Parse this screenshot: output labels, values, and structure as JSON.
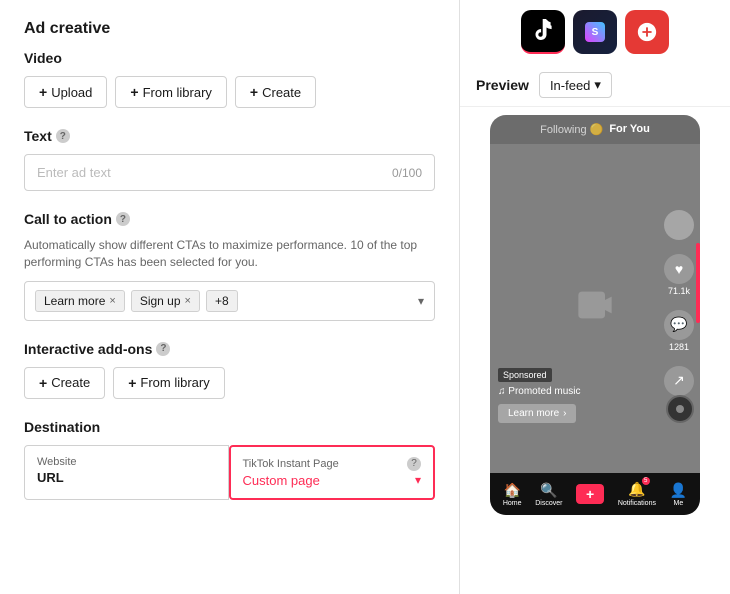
{
  "page": {
    "title": "Ad creative"
  },
  "video_section": {
    "label": "Video",
    "upload_btn": "Upload",
    "from_library_btn": "From library",
    "create_btn": "Create"
  },
  "text_section": {
    "label": "Text",
    "help": "?",
    "placeholder": "Enter ad text",
    "char_count": "0/100"
  },
  "cta_section": {
    "label": "Call to action",
    "help": "?",
    "description": "Automatically show different CTAs to maximize performance. 10 of the top performing CTAs has been selected for you.",
    "tags": [
      {
        "text": "Learn more",
        "removable": true
      },
      {
        "text": "Sign up",
        "removable": true
      }
    ],
    "more_count": "+8"
  },
  "interactive_section": {
    "label": "Interactive add-ons",
    "help": "?",
    "create_btn": "Create",
    "from_library_btn": "From library"
  },
  "destination_section": {
    "label": "Destination",
    "website_label": "Website",
    "website_value": "URL",
    "tiktok_label": "TikTok Instant Page",
    "tiktok_help": "?",
    "tiktok_value": "Custom page"
  },
  "preview": {
    "label": "Preview",
    "dropdown": "In-feed",
    "following_text": "Following",
    "for_you_text": "For You",
    "sponsored_text": "Sponsored",
    "music_text": "♫ Promoted music",
    "learn_more_btn": "Learn more",
    "nav_items": [
      {
        "label": "Home",
        "icon": "🏠"
      },
      {
        "label": "Discover",
        "icon": "🔍"
      },
      {
        "label": "+",
        "icon": "+"
      },
      {
        "label": "Notifications",
        "icon": "🔔"
      },
      {
        "label": "Me",
        "icon": "👤"
      }
    ]
  },
  "platforms": [
    {
      "name": "tiktok",
      "active": true
    },
    {
      "name": "other1",
      "active": false
    },
    {
      "name": "other2",
      "active": false
    }
  ],
  "colors": {
    "accent": "#fe2c55",
    "border": "#d0d0d0",
    "text_primary": "#1a1a1a",
    "text_secondary": "#666"
  }
}
